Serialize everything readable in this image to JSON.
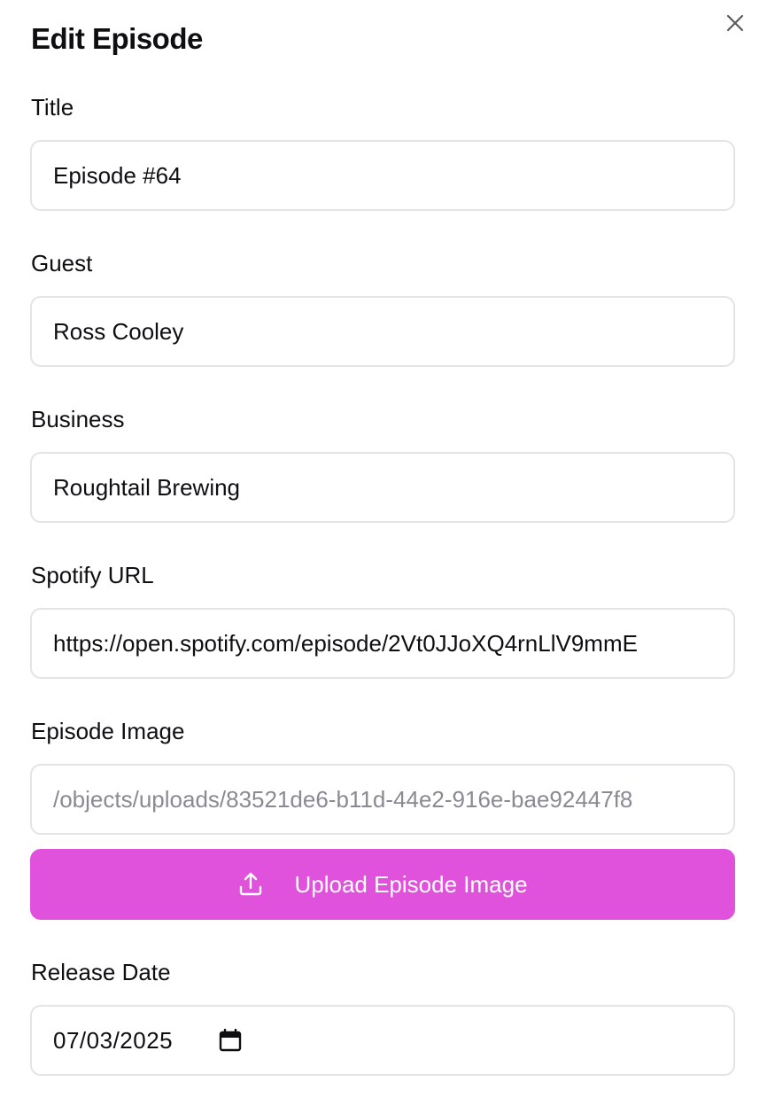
{
  "dialog": {
    "title": "Edit Episode"
  },
  "fields": {
    "title": {
      "label": "Title",
      "value": "Episode #64"
    },
    "guest": {
      "label": "Guest",
      "value": "Ross Cooley"
    },
    "business": {
      "label": "Business",
      "value": "Roughtail Brewing"
    },
    "spotify": {
      "label": "Spotify URL",
      "value": "https://open.spotify.com/episode/2Vt0JJoXQ4rnLlV9mmE"
    },
    "image": {
      "label": "Episode Image",
      "value": "/objects/uploads/83521de6-b11d-44e2-916e-bae92447f8"
    },
    "release_date": {
      "label": "Release Date",
      "value": "07/03/2025"
    }
  },
  "upload": {
    "label": "Upload Episode Image"
  },
  "icons": {
    "close": "close-icon",
    "upload": "upload-icon",
    "calendar": "calendar-icon"
  },
  "colors": {
    "accent": "#e052dc",
    "border": "#e4e4e7",
    "muted_text": "#8a8a93"
  }
}
